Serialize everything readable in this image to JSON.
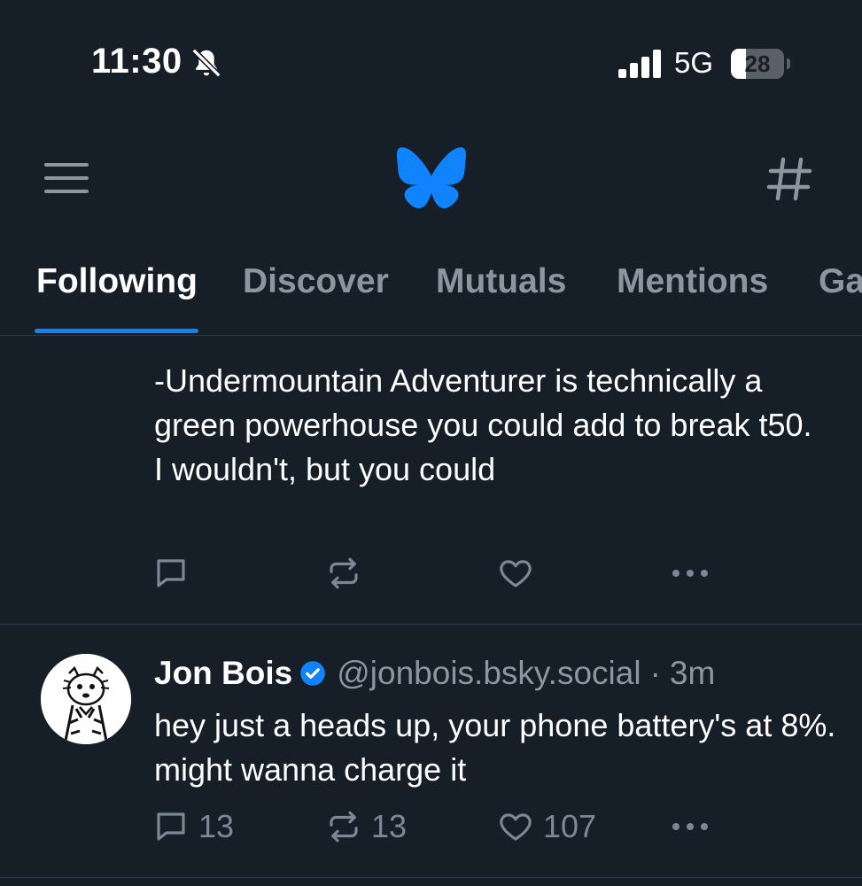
{
  "status_bar": {
    "time": "11:30",
    "network": "5G",
    "battery": "28",
    "battery_level": 0.28,
    "icons": [
      "bell-slash-icon",
      "cellular-signal-icon",
      "battery-icon"
    ]
  },
  "header": {
    "icons": [
      "menu-icon",
      "bluesky-butterfly-logo",
      "hashtag-icon"
    ],
    "logo_color": "#1083fe"
  },
  "tabs": [
    {
      "label": "Following",
      "active": true
    },
    {
      "label": "Discover",
      "active": false
    },
    {
      "label": "Mutuals",
      "active": false
    },
    {
      "label": "Mentions",
      "active": false
    },
    {
      "label": "Ga",
      "active": false
    }
  ],
  "posts": [
    {
      "text": "-Undermountain Adventurer is technically a green powerhouse you could add to break t50. I wouldn't, but you could",
      "actions": {
        "reply": "",
        "repost": "",
        "like": ""
      }
    },
    {
      "author": "Jon Bois",
      "handle": "@jonbois.bsky.social",
      "separator": "·",
      "time_ago": "3m",
      "verified": true,
      "text": "hey just a heads up, your phone battery's at 8%. might wanna charge it",
      "actions": {
        "reply": "13",
        "repost": "13",
        "like": "107"
      }
    }
  ],
  "colors": {
    "background": "#161e27",
    "accent": "#1083fe",
    "muted_text": "#8c95a1",
    "icon": "#7b8898"
  }
}
